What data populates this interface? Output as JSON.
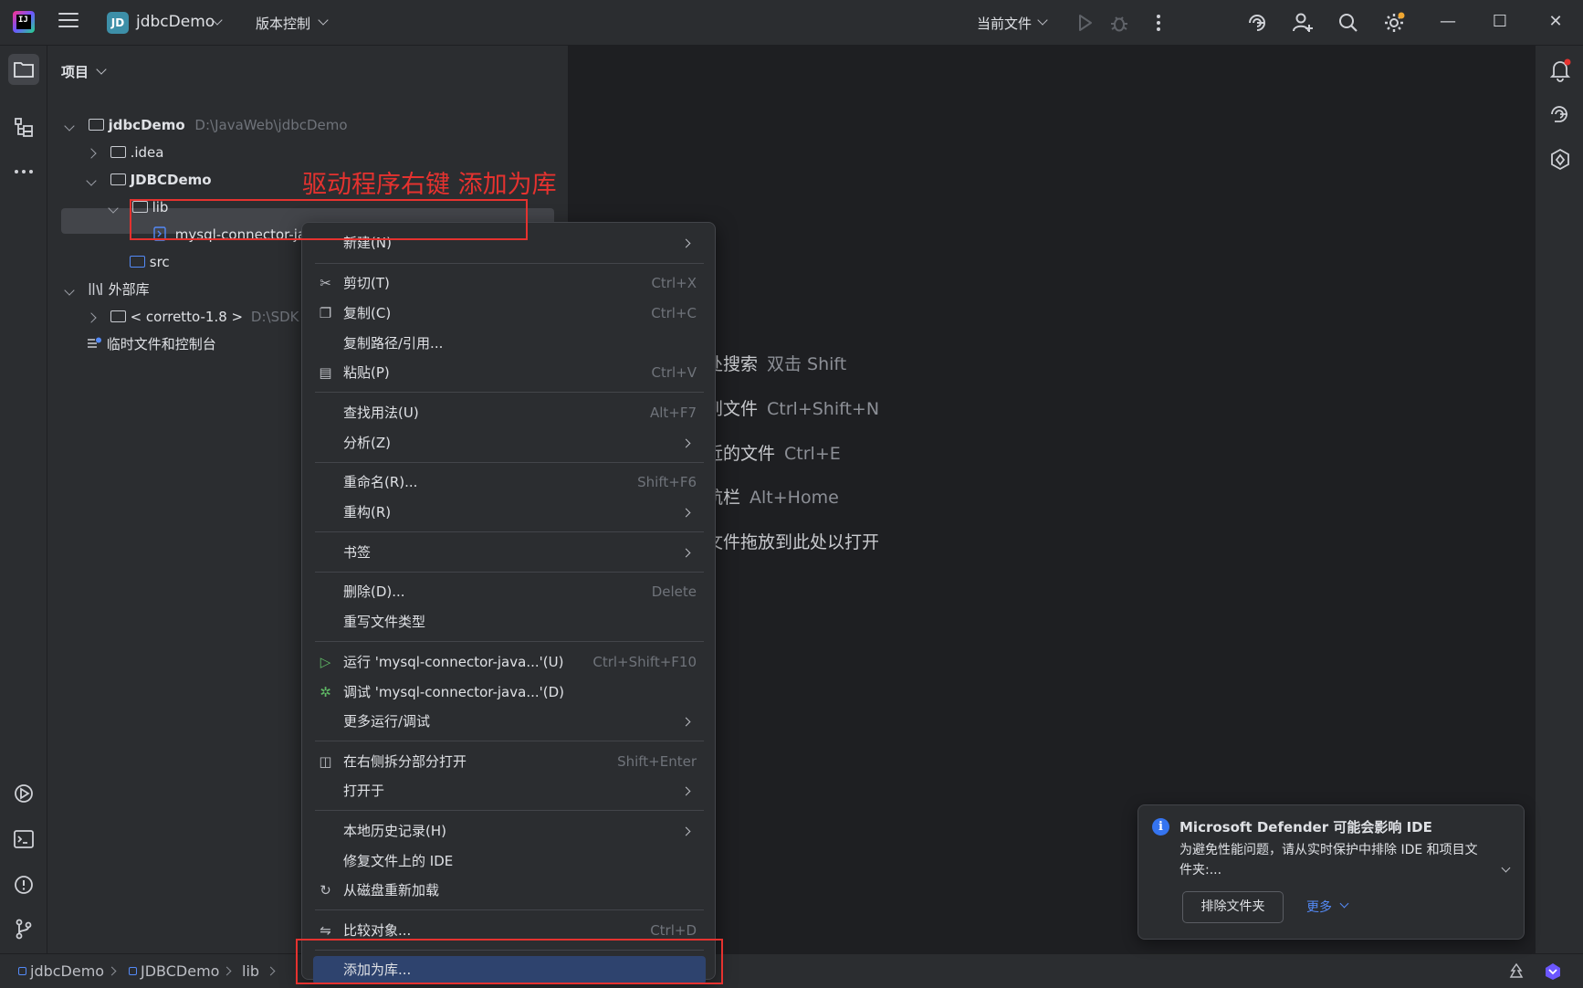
{
  "titlebar": {
    "project_badge": "JD",
    "project_name": "jdbcDemo",
    "vcs_label": "版本控制",
    "run_config": "当前文件"
  },
  "project_panel": {
    "title": "项目",
    "tree": [
      {
        "name": "jdbcDemo",
        "path": "D:\\JavaWeb\\jdbcDemo"
      },
      {
        "name": ".idea"
      },
      {
        "name": "JDBCDemo"
      },
      {
        "name": "lib"
      },
      {
        "name": "mysql-connector-java-5.1.48-bin.jar"
      },
      {
        "name": "src"
      },
      {
        "name": "外部库"
      },
      {
        "name": "< corretto-1.8 >",
        "path": "D:\\SDK"
      },
      {
        "name": "临时文件和控制台"
      }
    ]
  },
  "annotation": "驱动程序右键 添加为库",
  "context_menu": {
    "items": [
      {
        "label": "新建(N)",
        "shortcut": ""
      },
      {
        "label": "剪切(T)",
        "shortcut": "Ctrl+X"
      },
      {
        "label": "复制(C)",
        "shortcut": "Ctrl+C"
      },
      {
        "label": "复制路径/引用...",
        "shortcut": ""
      },
      {
        "label": "粘贴(P)",
        "shortcut": "Ctrl+V"
      },
      {
        "label": "查找用法(U)",
        "shortcut": "Alt+F7"
      },
      {
        "label": "分析(Z)",
        "shortcut": ""
      },
      {
        "label": "重命名(R)...",
        "shortcut": "Shift+F6"
      },
      {
        "label": "重构(R)",
        "shortcut": ""
      },
      {
        "label": "书签",
        "shortcut": ""
      },
      {
        "label": "删除(D)...",
        "shortcut": "Delete"
      },
      {
        "label": "重写文件类型",
        "shortcut": ""
      },
      {
        "label": "运行 'mysql-connector-java...'(U)",
        "shortcut": "Ctrl+Shift+F10"
      },
      {
        "label": "调试 'mysql-connector-java...'(D)",
        "shortcut": ""
      },
      {
        "label": "更多运行/调试",
        "shortcut": ""
      },
      {
        "label": "在右侧拆分部分打开",
        "shortcut": "Shift+Enter"
      },
      {
        "label": "打开于",
        "shortcut": ""
      },
      {
        "label": "本地历史记录(H)",
        "shortcut": ""
      },
      {
        "label": "修复文件上的 IDE",
        "shortcut": ""
      },
      {
        "label": "从磁盘重新加载",
        "shortcut": ""
      },
      {
        "label": "比较对象...",
        "shortcut": "Ctrl+D"
      },
      {
        "label": "添加为库...",
        "shortcut": ""
      }
    ]
  },
  "editor_hints": [
    {
      "label": "处搜索",
      "key": "双击 Shift"
    },
    {
      "label": "到文件",
      "key": "Ctrl+Shift+N"
    },
    {
      "label": "近的文件",
      "key": "Ctrl+E"
    },
    {
      "label": "航栏",
      "key": "Alt+Home"
    },
    {
      "label": "文件拖放到此处以打开",
      "key": ""
    }
  ],
  "notification": {
    "title": "Microsoft Defender 可能会影响 IDE",
    "body": "为避免性能问题，请从实时保护中排除 IDE 和项目文件夹:...",
    "button": "排除文件夹",
    "more": "更多"
  },
  "statusbar": {
    "crumbs": [
      "jdbcDemo",
      "JDBCDemo",
      "lib"
    ]
  },
  "colors": {
    "accent": "#3574f0",
    "annotation_red": "#e5322f",
    "menu_highlight": "#2e436e"
  }
}
